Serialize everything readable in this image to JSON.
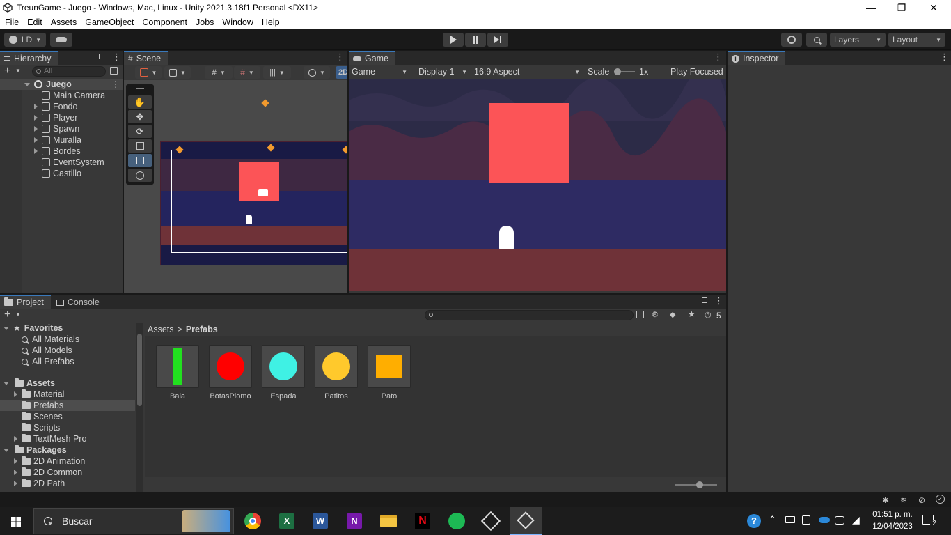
{
  "window": {
    "title": "TreunGame - Juego - Windows, Mac, Linux - Unity 2021.3.18f1 Personal <DX11>",
    "minimize": "—",
    "restore": "❐",
    "close": "✕"
  },
  "menu": [
    "File",
    "Edit",
    "Assets",
    "GameObject",
    "Component",
    "Jobs",
    "Window",
    "Help"
  ],
  "toolbar": {
    "account": "LD",
    "layers": "Layers",
    "layout": "Layout"
  },
  "hierarchy": {
    "tab": "Hierarchy",
    "search_placeholder": "All",
    "scene": "Juego",
    "items": [
      {
        "label": "Main Camera",
        "expandable": false
      },
      {
        "label": "Fondo",
        "expandable": true
      },
      {
        "label": "Player",
        "expandable": true
      },
      {
        "label": "Spawn",
        "expandable": true
      },
      {
        "label": "Muralla",
        "expandable": true
      },
      {
        "label": "Bordes",
        "expandable": true
      },
      {
        "label": "EventSystem",
        "expandable": false
      },
      {
        "label": "Castillo",
        "expandable": false
      }
    ]
  },
  "scene": {
    "tab": "Scene",
    "mode_2d": "2D"
  },
  "game": {
    "tab": "Game",
    "view": "Game",
    "display": "Display 1",
    "aspect": "16:9 Aspect",
    "scale_label": "Scale",
    "scale_value": "1x",
    "play_focused": "Play Focused"
  },
  "inspector": {
    "tab": "Inspector"
  },
  "project": {
    "tab": "Project",
    "console_tab": "Console",
    "breadcrumb": [
      "Assets",
      "Prefabs"
    ],
    "hidden_count": "5",
    "favorites": {
      "label": "Favorites",
      "items": [
        "All Materials",
        "All Models",
        "All Prefabs"
      ]
    },
    "assets": {
      "label": "Assets",
      "items": [
        "Material",
        "Prefabs",
        "Scenes",
        "Scripts",
        "TextMesh Pro"
      ]
    },
    "packages": {
      "label": "Packages",
      "items": [
        "2D Animation",
        "2D Common",
        "2D Path"
      ]
    },
    "prefabs": [
      {
        "name": "Bala",
        "shape": "bar",
        "color": "#22e01f"
      },
      {
        "name": "BotasPlomo",
        "shape": "circle",
        "color": "#ff0000"
      },
      {
        "name": "Espada",
        "shape": "circle",
        "color": "#3ff1e4"
      },
      {
        "name": "Patitos",
        "shape": "circle",
        "color": "#ffc92c"
      },
      {
        "name": "Pato",
        "shape": "square",
        "color": "#ffae00"
      }
    ]
  },
  "taskbar": {
    "search": "Buscar",
    "time": "01:51 p. m.",
    "date": "12/04/2023",
    "notifications": "2"
  },
  "colors": {
    "game_sky_top": "#2c2b47",
    "game_band": "#4a2b45",
    "game_water": "#2e2b63",
    "game_ground": "#6f3238",
    "red_square": "#fc5457",
    "accent": "#3a79bb"
  }
}
